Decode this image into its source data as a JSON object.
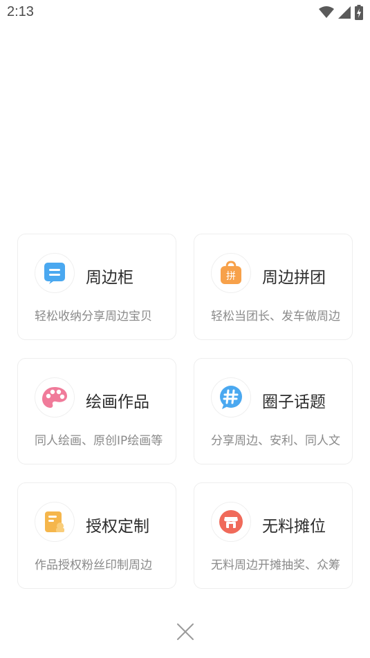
{
  "status_bar": {
    "time": "2:13"
  },
  "cards": [
    {
      "title": "周边柜",
      "subtitle": "轻松收纳分享周边宝贝",
      "icon": "shelf-icon",
      "color": "#4aa8f0"
    },
    {
      "title": "周边拼团",
      "subtitle": "轻松当团长、发车做周边",
      "icon": "group-buy-icon",
      "color": "#f7a14a",
      "icon_text": "拼"
    },
    {
      "title": "绘画作品",
      "subtitle": "同人绘画、原创IP绘画等",
      "icon": "palette-icon",
      "color": "#f07b9a"
    },
    {
      "title": "圈子话题",
      "subtitle": "分享周边、安利、同人文",
      "icon": "hashtag-icon",
      "color": "#4aa8f0"
    },
    {
      "title": "授权定制",
      "subtitle": "作品授权粉丝印制周边",
      "icon": "license-icon",
      "color": "#f5b64c"
    },
    {
      "title": "无料摊位",
      "subtitle": "无料周边开摊抽奖、众筹",
      "icon": "booth-icon",
      "color": "#f06a5a"
    }
  ],
  "close": {
    "icon": "close-icon"
  }
}
